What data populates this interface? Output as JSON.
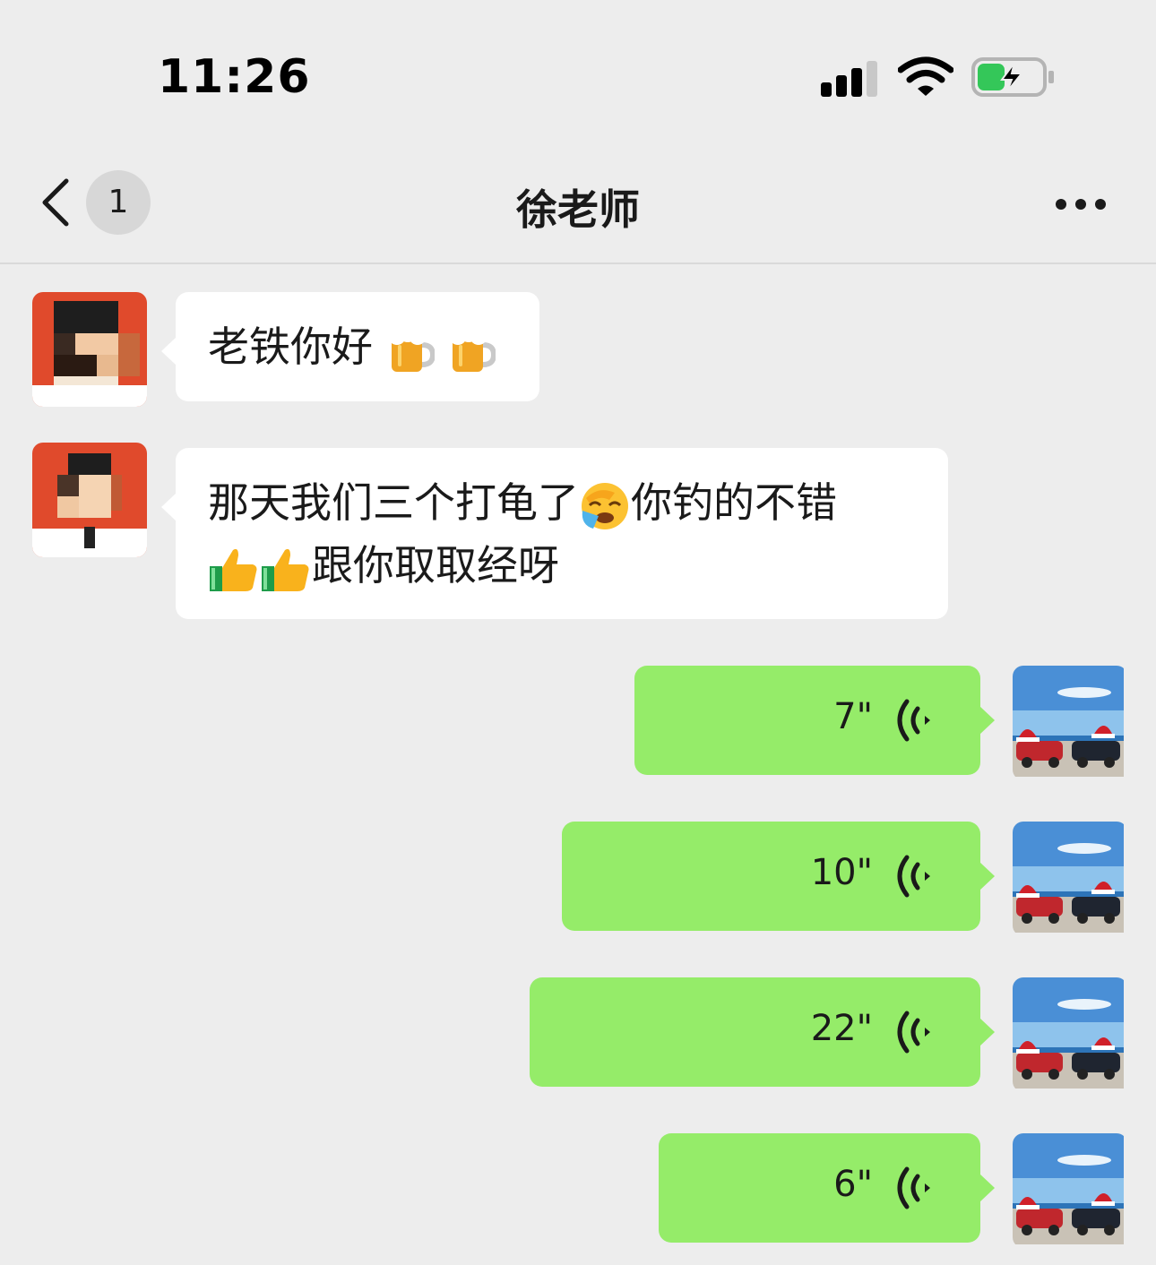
{
  "status_bar": {
    "time": "11:26"
  },
  "nav": {
    "unread_count": "1",
    "title": "徐老师"
  },
  "messages_in": [
    {
      "text": "老铁你好",
      "emoji": [
        "beer-mug",
        "beer-mug"
      ]
    },
    {
      "line1": "那天我们三个打龟了",
      "line1_after": "你钓的不错",
      "line2": "跟你取取经呀",
      "emoji": [
        "face-palm",
        "thumbs-up",
        "thumbs-up"
      ]
    }
  ],
  "voice_messages": [
    {
      "duration": "7\""
    },
    {
      "duration": "10\""
    },
    {
      "duration": "22\""
    },
    {
      "duration": "6\""
    }
  ],
  "colors": {
    "background": "#ededed",
    "outgoing_bubble": "#95ec69",
    "incoming_bubble": "#ffffff",
    "battery_fill": "#34c759"
  }
}
